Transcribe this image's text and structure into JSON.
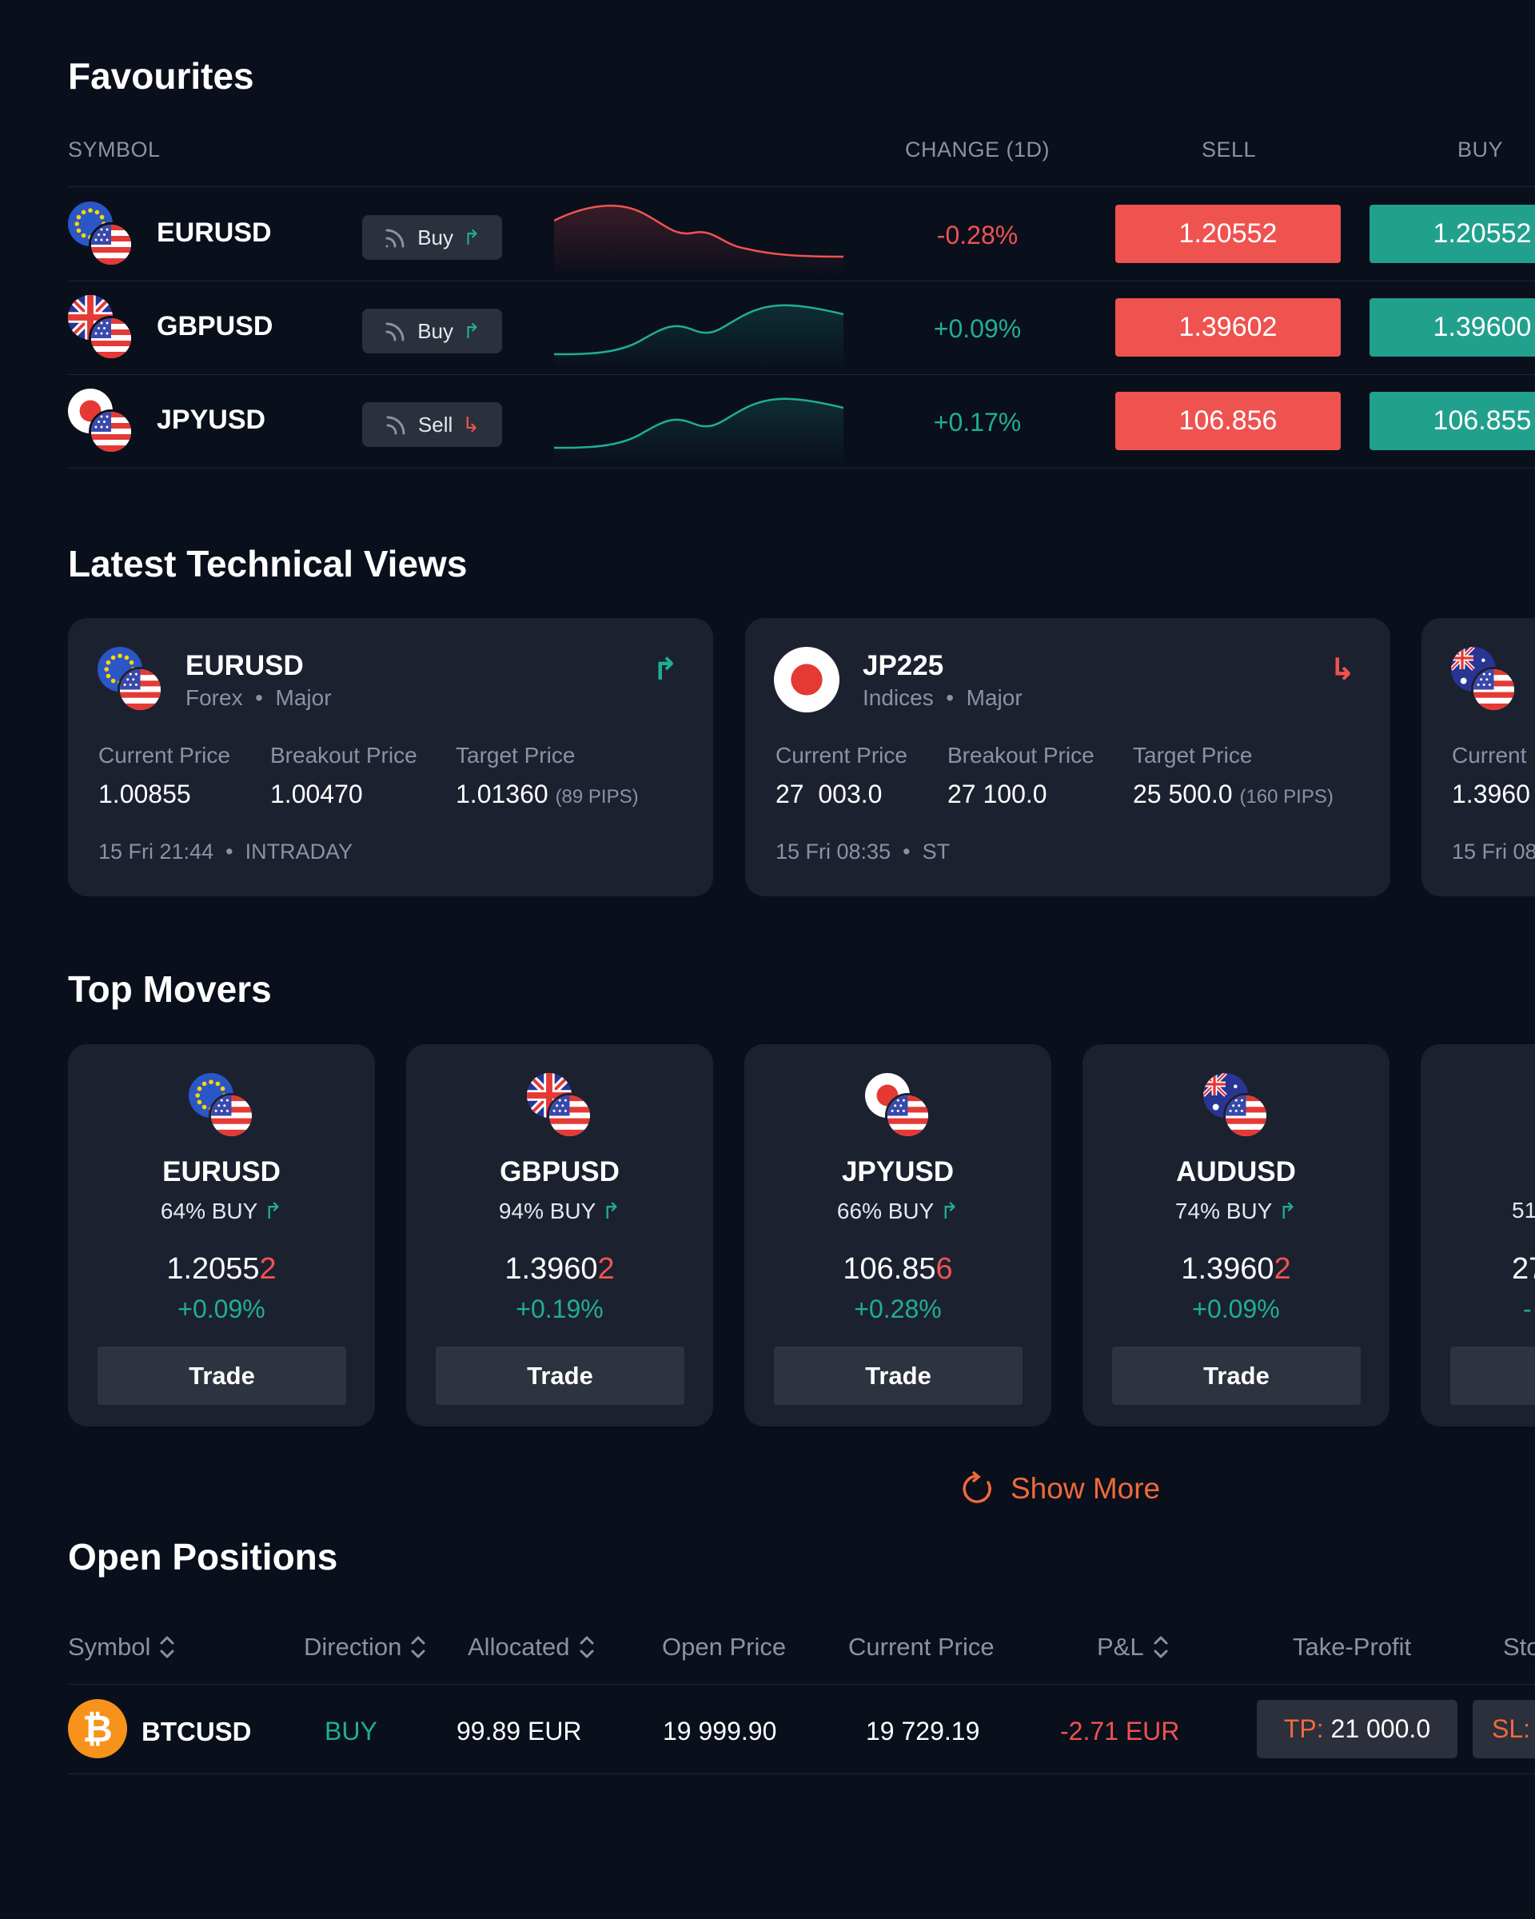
{
  "favourites": {
    "title": "Favourites",
    "columns": {
      "symbol": "SYMBOL",
      "change": "CHANGE (1D)",
      "sell": "SELL",
      "buy": "BUY"
    },
    "rows": [
      {
        "symbol": "EURUSD",
        "signal": "Buy",
        "signal_arrow": "↗",
        "change": "-0.28%",
        "sell": "1.20552",
        "buy": "1.20552",
        "trend": "down"
      },
      {
        "symbol": "GBPUSD",
        "signal": "Buy",
        "signal_arrow": "↗",
        "change": "+0.09%",
        "sell": "1.39602",
        "buy": "1.39600",
        "trend": "up"
      },
      {
        "symbol": "JPYUSD",
        "signal": "Sell",
        "signal_arrow": "↘",
        "change": "+0.17%",
        "sell": "106.856",
        "buy": "106.855",
        "trend": "up"
      }
    ]
  },
  "technical": {
    "title": "Latest Technical Views",
    "labels": {
      "current": "Current Price",
      "breakout": "Breakout Price",
      "target": "Target Price"
    },
    "cards": [
      {
        "symbol": "EURUSD",
        "category": "Forex",
        "tier": "Major",
        "current": "1.00855",
        "breakout": "1.00470",
        "target": "1.01360",
        "pips": "(89 PIPS)",
        "time": "15 Fri 21:44",
        "horizon": "INTRADAY"
      },
      {
        "symbol": "JP225",
        "category": "Indices",
        "tier": "Major",
        "current": "27  003.0",
        "breakout": "27 100.0",
        "target": "25 500.0",
        "pips": "(160 PIPS)",
        "time": "15 Fri 08:35",
        "horizon": "ST"
      },
      {
        "symbol": "",
        "category": "",
        "tier": "",
        "current_label": "Current",
        "current": "1.3960",
        "time": "15 Fri 08"
      }
    ]
  },
  "movers": {
    "title": "Top Movers",
    "trade_label": "Trade",
    "cards": [
      {
        "symbol": "EURUSD",
        "buy_pct": "64% BUY",
        "price_main": "1.2055",
        "price_last": "2",
        "change": "+0.09%"
      },
      {
        "symbol": "GBPUSD",
        "buy_pct": "94% BUY",
        "price_main": "1.3960",
        "price_last": "2",
        "change": "+0.19%"
      },
      {
        "symbol": "JPYUSD",
        "buy_pct": "66% BUY",
        "price_main": "106.85",
        "price_last": "6",
        "change": "+0.28%"
      },
      {
        "symbol": "AUDUSD",
        "buy_pct": "74% BUY",
        "price_main": "1.3960",
        "price_last": "2",
        "change": "+0.09%"
      },
      {
        "symbol_partial": "D",
        "buy_pct_partial": "51",
        "price_partial": "27"
      }
    ],
    "show_more": "Show More"
  },
  "positions": {
    "title": "Open Positions",
    "columns": {
      "symbol": "Symbol",
      "direction": "Direction",
      "allocated": "Allocated",
      "open_price": "Open Price",
      "current_price": "Current Price",
      "pnl": "P&L",
      "take_profit": "Take-Profit",
      "stop_loss": "Sto"
    },
    "rows": [
      {
        "symbol": "BTCUSD",
        "direction": "BUY",
        "allocated": "99.89 EUR",
        "open_price": "19 999.90",
        "current_price": "19 729.19",
        "pnl": "-2.71 EUR",
        "tp_label": "TP:",
        "tp_value": "21 000.0",
        "sl_label": "SL:"
      }
    ]
  },
  "colors": {
    "background": "#0a0f1c",
    "card": "#1c2130",
    "sell": "#ef5350",
    "buy": "#22a08e",
    "positive": "#1fae96",
    "negative": "#ef5350",
    "accent": "#ef6a3a"
  }
}
